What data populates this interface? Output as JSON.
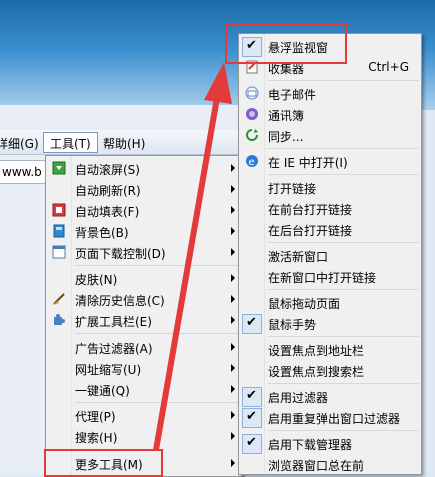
{
  "menubar": {
    "items": [
      {
        "label": "详细(G)"
      },
      {
        "label": "工具(T)"
      },
      {
        "label": "帮助(H)"
      }
    ]
  },
  "address": {
    "value": "www.b"
  },
  "tools_menu": {
    "items": [
      {
        "label": "自动滚屏(S)",
        "icon": "scroll-icon"
      },
      {
        "label": "自动刷新(R)"
      },
      {
        "label": "自动填表(F)",
        "icon": "form-fill-icon"
      },
      {
        "label": "背景色(B)",
        "icon": "background-color-icon"
      },
      {
        "label": "页面下载控制(D)",
        "icon": "download-control-icon"
      },
      {
        "label": "皮肤(N)"
      },
      {
        "label": "清除历史信息(C)",
        "icon": "broom-icon"
      },
      {
        "label": "扩展工具栏(E)",
        "icon": "puzzle-icon"
      },
      {
        "label": "广告过滤器(A)"
      },
      {
        "label": "网址缩写(U)"
      },
      {
        "label": "一键通(Q)"
      },
      {
        "label": "代理(P)"
      },
      {
        "label": "搜索(H)"
      },
      {
        "label": "更多工具(M)"
      }
    ]
  },
  "more_tools_menu": {
    "items": [
      {
        "label": "悬浮监视窗",
        "checked": true
      },
      {
        "label": "收集器",
        "shortcut": "Ctrl+G",
        "icon": "collector-icon"
      },
      {
        "label": "电子邮件",
        "icon": "email-icon"
      },
      {
        "label": "通讯簿",
        "icon": "address-book-icon"
      },
      {
        "label": "同步...",
        "icon": "sync-icon"
      },
      {
        "label": "在 IE 中打开(I)",
        "icon": "ie-icon"
      },
      {
        "label": "打开链接"
      },
      {
        "label": "在前台打开链接"
      },
      {
        "label": "在后台打开链接"
      },
      {
        "label": "激活新窗口"
      },
      {
        "label": "在新窗口中打开链接"
      },
      {
        "label": "鼠标拖动页面"
      },
      {
        "label": "鼠标手势",
        "checked": true
      },
      {
        "label": "设置焦点到地址栏"
      },
      {
        "label": "设置焦点到搜索栏"
      },
      {
        "label": "启用过滤器",
        "checked": true
      },
      {
        "label": "启用重复弹出窗口过滤器",
        "checked": true
      },
      {
        "label": "启用下载管理器",
        "checked": true
      },
      {
        "label": "浏览器窗口总在前"
      }
    ]
  },
  "colors": {
    "highlight": "#e33a3a",
    "arrow": "#e33a3a"
  }
}
